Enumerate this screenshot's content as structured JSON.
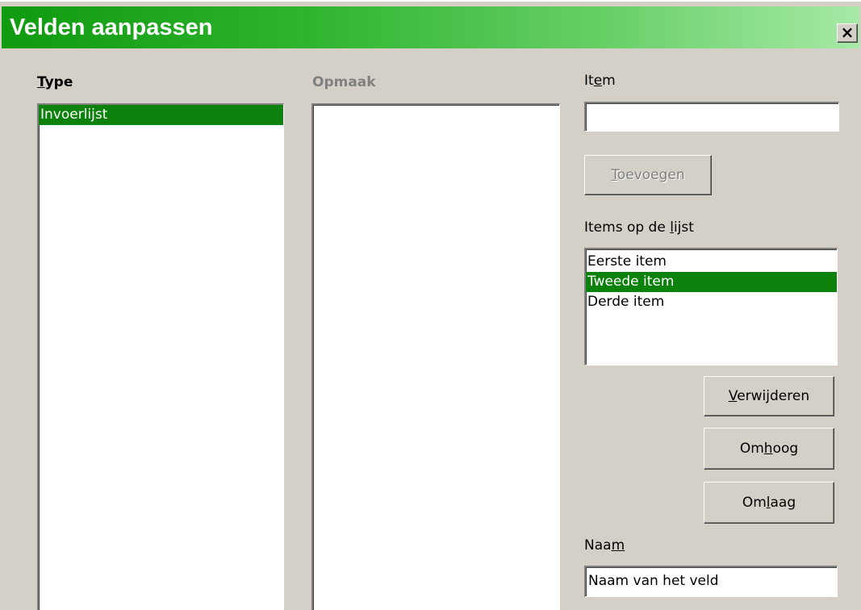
{
  "window": {
    "title": "Velden aanpassen",
    "close_symbol": "×",
    "close_icon": "close-icon"
  },
  "type_panel": {
    "label": "Type",
    "items": [
      {
        "label": "Invoerlijst",
        "selected": true
      }
    ]
  },
  "format_panel": {
    "label": "Opmaak",
    "enabled": false,
    "items": []
  },
  "item_field": {
    "label": "Item",
    "value": ""
  },
  "add_button": {
    "label": "Toevoegen",
    "enabled": false
  },
  "items_list": {
    "label": "Items op de lijst",
    "items": [
      {
        "label": "Eerste item",
        "selected": false
      },
      {
        "label": "Tweede item",
        "selected": true
      },
      {
        "label": "Derde item",
        "selected": false
      }
    ]
  },
  "buttons": {
    "remove": "Verwijderen",
    "up": "Omhoog",
    "down": "Omlaag"
  },
  "name_field": {
    "label": "Naam",
    "value": "Naam van het veld"
  },
  "colors": {
    "selection": "#0c820c",
    "dialog_bg": "#d4d0c8",
    "title_gradient_start": "#0f9a0f",
    "title_gradient_end": "#a6e9a6"
  }
}
